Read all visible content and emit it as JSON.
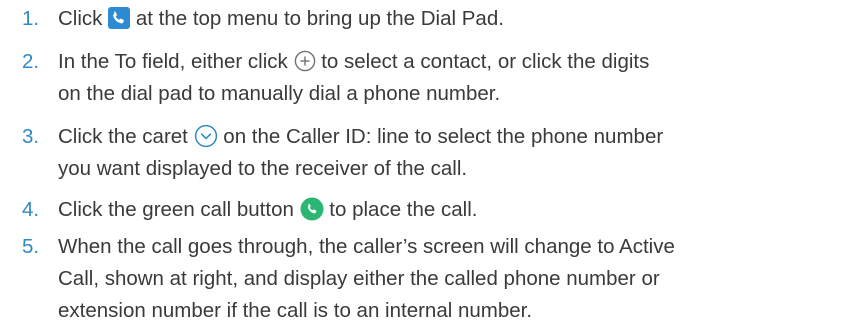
{
  "steps": [
    {
      "number": "1.",
      "before": "Click",
      "icon": "phone-square-icon",
      "after": "at the top menu to bring up the Dial Pad."
    },
    {
      "number": "2.",
      "before": "In the To field, either click",
      "icon": "plus-circle-icon",
      "after": "to select a contact, or click the digits",
      "line2": "on the dial pad to manually dial a phone number."
    },
    {
      "number": "3.",
      "before": "Click the caret",
      "icon": "chevron-down-circle-icon",
      "after": "on the Caller ID: line to select the phone number",
      "line2": "you want displayed to the receiver of the call."
    },
    {
      "number": "4.",
      "before": "Click the green call button",
      "icon": "green-call-button-icon",
      "after": "to place the call."
    },
    {
      "number": "5.",
      "line1": "When the call goes through, the caller’s screen will change to Active",
      "line2": "Call, shown at right, and display either the called phone number or",
      "line3": "extension number if the call is to an internal number."
    }
  ],
  "colors": {
    "text": "#3a3a3a",
    "number": "#2f8ac4",
    "phone_square": "#2d8bd3",
    "call_button": "#2bb673",
    "outline_icon_plus": "#6f6f6f",
    "outline_icon_caret": "#2f8ac4"
  }
}
